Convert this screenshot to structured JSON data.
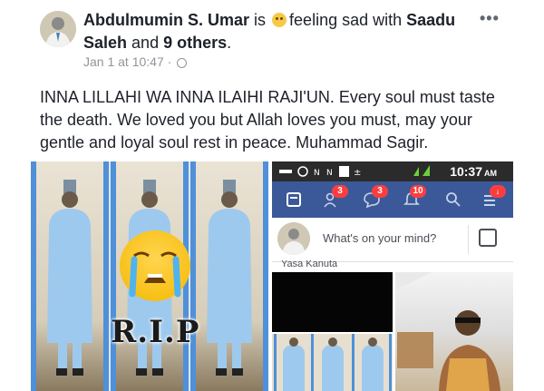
{
  "post": {
    "author": "Abdulmumin S. Umar",
    "is_text": "is",
    "feeling_text": "feeling sad with",
    "tagged_person": "Saadu Saleh",
    "and_text": "and",
    "others": "9 others",
    "period": ".",
    "date": "Jan 1 at 10:47",
    "dot": "·",
    "privacy_icon": "globe-icon",
    "more_label": "•••",
    "body": "INNA LILLAHI WA INNA ILAIHI RAJI'UN. Every soul must taste the death. We loved you but Allah loves you must, may your gentle and loyal soul rest in peace. Muhammad Sagir."
  },
  "left_photo": {
    "caption": "R.I.P",
    "emoji": "crying-face-icon"
  },
  "phone_screenshot": {
    "time": "10:37",
    "ampm": "AM",
    "badges": {
      "friends": "3",
      "messages": "3",
      "notifications": "10"
    },
    "composer_placeholder": "What's on your mind?",
    "cut_name": "Yasa Kanuta"
  },
  "colors": {
    "fb_blue": "#3b5998",
    "badge_red": "#fa3e3e",
    "frame_blue": "#4f90d8"
  }
}
